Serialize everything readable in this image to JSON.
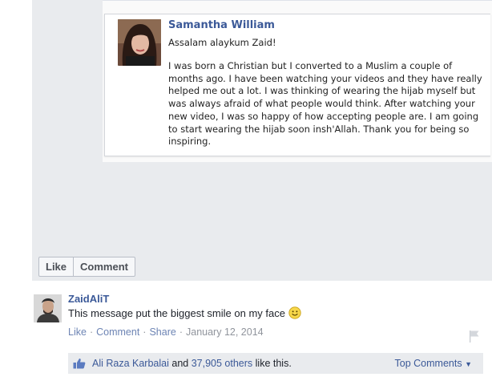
{
  "message": {
    "sender_name": "Samantha William",
    "greeting": "Assalam alaykum Zaid!",
    "body": "I was born a Christian but I converted to a Muslim a couple of months ago. I have been watching your videos and they have really helped me out a lot. I was thinking of wearing the hijab myself but was always afraid of what people would think. After watching your new video, I was so happy of how accepting people are. I am going to start wearing the hijab soon insh'Allah. Thank you for being so inspiring."
  },
  "actions": {
    "like_label": "Like",
    "comment_label": "Comment"
  },
  "comment": {
    "author": "ZaidAliT",
    "text": "This message put the biggest smile on my face",
    "emoji_icon": "smiley-icon",
    "like_link": "Like",
    "comment_link": "Comment",
    "share_link": "Share",
    "date": "January 12, 2014"
  },
  "likes": {
    "first_liker": "Ali Raza Karbalai",
    "and_text": "and",
    "others_count": "37,905 others",
    "suffix": "like this.",
    "top_comments_label": "Top Comments"
  },
  "colors": {
    "link": "#3b5998",
    "post_background": "#e9ebee",
    "meta_text": "#90949c"
  }
}
